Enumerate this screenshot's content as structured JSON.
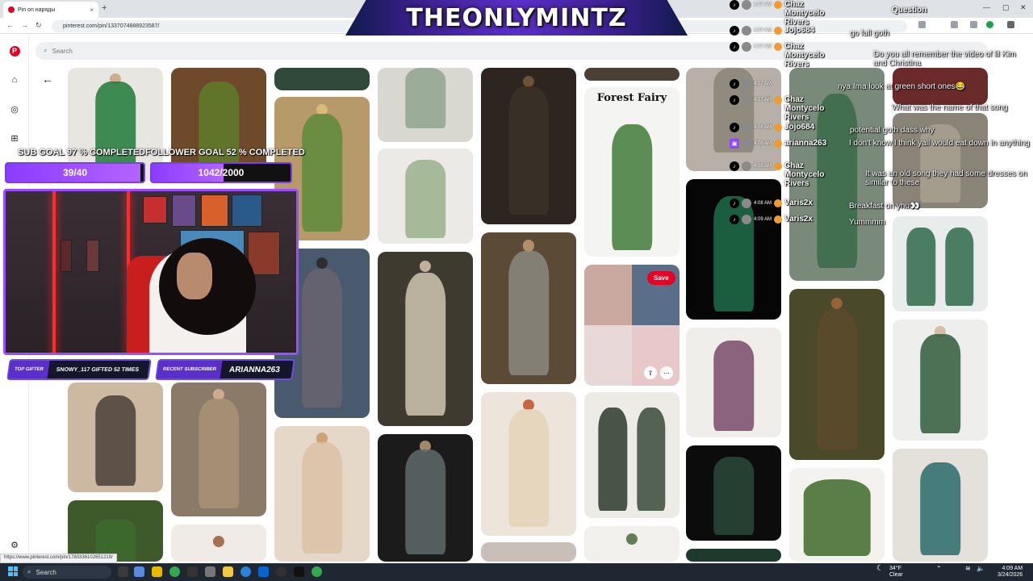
{
  "browser": {
    "tab_title": "Pin on наряды",
    "tab_close": "×",
    "new_tab": "+",
    "url": "pinterest.com/pin/1337074888923587/",
    "status_url": "https://www.pinterest.com/pin/1780336102651219/"
  },
  "pinterest": {
    "search_placeholder": "Search",
    "back_arrow": "←",
    "save_label": "Save",
    "board_title": "Forest Fairy"
  },
  "stream": {
    "banner_title": "THEONLYMINTZ",
    "sub_goal_label": "SUB GOAL 97 % COMPLETED",
    "sub_goal_value": "39/40",
    "sub_goal_fraction": 0.975,
    "follower_goal_label": "FOLLOWER GOAL 52 % COMPLETED",
    "follower_goal_value": "1042/2000",
    "follower_goal_fraction": 0.52,
    "top_gifter_key": "TOP GIFTER",
    "top_gifter_value": "SNOWY_117 GIFTED 52 TIMES",
    "recent_sub_key": "RECENT SUBSCRIBER",
    "recent_sub_value": "ARIANNA263"
  },
  "chat": {
    "question_label": "Question",
    "messages": [
      {
        "platform": "tiktok",
        "time": "4:07 AM",
        "user": "Chaz Montycelo Rivers",
        "text": ""
      },
      {
        "platform": "tiktok",
        "time": "4:07 AM",
        "user": "Jojo684",
        "text": "go full goth"
      },
      {
        "platform": "tiktok",
        "time": "4:07 AM",
        "user": "Chaz Montycelo Rivers",
        "text": "Do you all remember the video of lil Kim and Christina"
      },
      {
        "platform": "tiktok",
        "time": "4:07 AM",
        "user": "",
        "text": "nya Ima look at green short ones😂"
      },
      {
        "platform": "tiktok",
        "time": "4:07 AM",
        "user": "Chaz Montycelo Rivers",
        "text": "What was the name of that song"
      },
      {
        "platform": "tiktok",
        "time": "4:08 AM",
        "user": "Jojo684",
        "text": "potential goth dass why"
      },
      {
        "platform": "twitch",
        "time": "4:08 AM",
        "user": "arianna263",
        "text": "I don't know I think yall would eat down in anything"
      },
      {
        "platform": "tiktok",
        "time": "4:08 AM",
        "user": "Chaz Montycelo Rivers",
        "text": "It was an old song they had some dresses on similar to these"
      },
      {
        "platform": "tiktok",
        "time": "4:08 AM",
        "user": "Varis2x",
        "text": "Breakfast on yhu👀"
      },
      {
        "platform": "tiktok",
        "time": "4:09 AM",
        "user": "Varis2x",
        "text": "Yummmm"
      }
    ]
  },
  "taskbar": {
    "search_label": "Search",
    "weather_temp": "34°F",
    "weather_desc": "Clear",
    "clock_time": "4:09 AM",
    "clock_date": "3/24/2026"
  },
  "colors": {
    "pinterest_red": "#e60023",
    "stream_purple": "#8a3cff",
    "led_red": "#ff2a2a"
  }
}
